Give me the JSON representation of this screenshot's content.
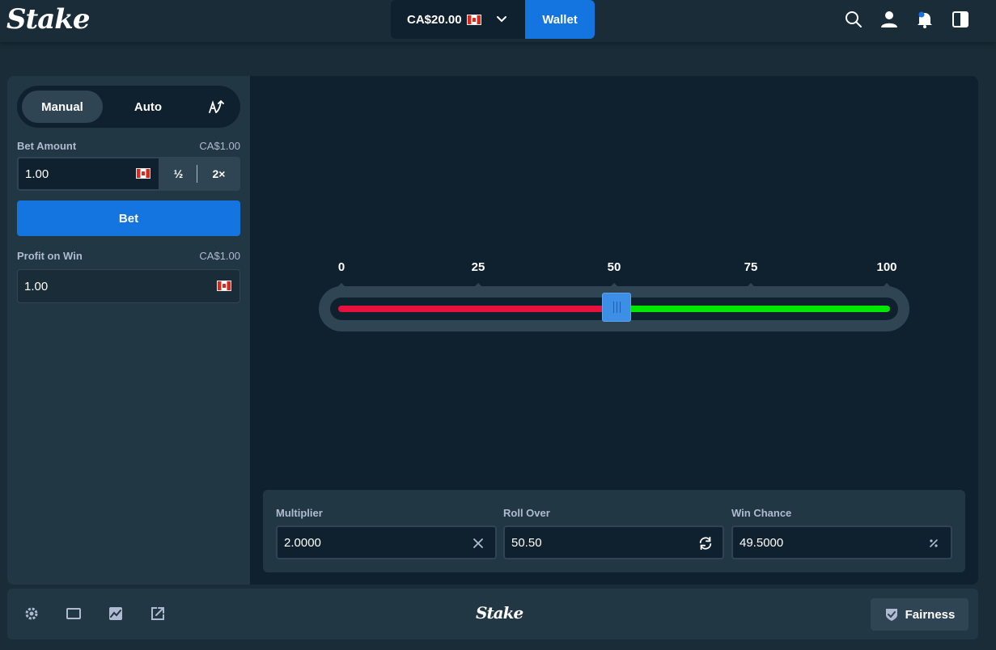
{
  "header": {
    "logo": "Stake",
    "balance": "CA$20.00",
    "wallet_label": "Wallet"
  },
  "sidebar": {
    "tabs": [
      {
        "label": "Manual"
      },
      {
        "label": "Auto"
      }
    ],
    "bet_amount_label": "Bet Amount",
    "bet_amount_value_display": "CA$1.00",
    "bet_amount": "1.00",
    "half_label": "½",
    "double_label": "2×",
    "bet_button_label": "Bet",
    "profit_label": "Profit on Win",
    "profit_value_display": "CA$1.00",
    "profit_amount": "1.00"
  },
  "slider": {
    "ticks": [
      "0",
      "25",
      "50",
      "75",
      "100"
    ],
    "min": 0,
    "max": 100,
    "value": 50.5,
    "lose_color": "#e9113c",
    "win_color": "#00e701"
  },
  "calculator": {
    "multiplier_label": "Multiplier",
    "multiplier_value": "2.0000",
    "roll_over_label": "Roll Over",
    "roll_over_value": "50.50",
    "win_chance_label": "Win Chance",
    "win_chance_value": "49.5000"
  },
  "footer": {
    "logo": "Stake",
    "fairness_label": "Fairness"
  },
  "colors": {
    "accent": "#1475e1",
    "background": "#1a2c38",
    "panel": "#213743",
    "dark": "#0f212e"
  },
  "icons": [
    "search-icon",
    "user-icon",
    "bell-icon",
    "sidebar-toggle-icon",
    "gear-icon",
    "theatre-mode-icon",
    "stats-icon",
    "popout-icon",
    "shield-check-icon"
  ]
}
